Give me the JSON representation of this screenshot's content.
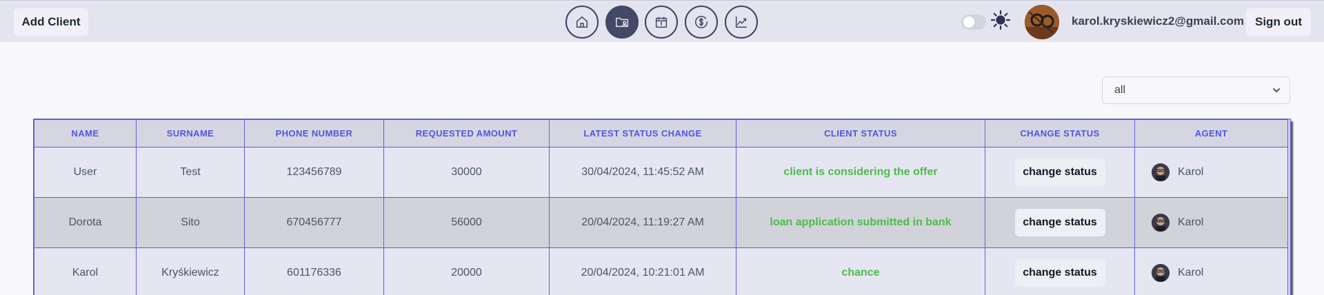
{
  "header": {
    "add_client_label": "Add Client",
    "sign_out_label": "Sign out",
    "user_email": "karol.kryskiewicz2@gmail.com",
    "nav": [
      {
        "name": "home",
        "icon": "home-icon",
        "active": false
      },
      {
        "name": "clients",
        "icon": "folder-user-icon",
        "active": true
      },
      {
        "name": "calendar",
        "icon": "calendar-icon",
        "active": false
      },
      {
        "name": "finance",
        "icon": "dollar-circle-icon",
        "active": false
      },
      {
        "name": "stats",
        "icon": "chart-line-icon",
        "active": false
      }
    ],
    "theme_toggle_on": false,
    "theme_icon": "sun-icon"
  },
  "filter": {
    "selected": "all"
  },
  "table": {
    "headers": [
      "NAME",
      "SURNAME",
      "PHONE NUMBER",
      "REQUESTED AMOUNT",
      "LATEST STATUS CHANGE",
      "CLIENT STATUS",
      "CHANGE STATUS",
      "AGENT"
    ],
    "rows": [
      {
        "name": "User",
        "surname": "Test",
        "phone": "123456789",
        "amount": "30000",
        "changed": "30/04/2024, 11:45:52 AM",
        "status": "client is considering the offer",
        "action": "change status",
        "agent": "Karol"
      },
      {
        "name": "Dorota",
        "surname": "Sito",
        "phone": "670456777",
        "amount": "56000",
        "changed": "20/04/2024, 11:19:27 AM",
        "status": "loan application submitted in bank",
        "action": "change status",
        "agent": "Karol"
      },
      {
        "name": "Karol",
        "surname": "Kryśkiewicz",
        "phone": "601176336",
        "amount": "20000",
        "changed": "20/04/2024, 10:21:01 AM",
        "status": "chance",
        "action": "change status",
        "agent": "Karol"
      }
    ]
  },
  "colors": {
    "accent": "#4f55e0",
    "status_green": "#4cbb4c",
    "nav_active": "#454968",
    "topbar": "#e4e4ef"
  }
}
